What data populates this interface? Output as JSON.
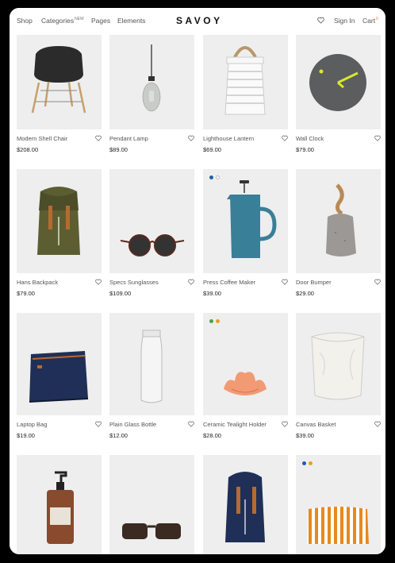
{
  "header": {
    "nav": [
      "Shop",
      "Categories",
      "Pages",
      "Elements"
    ],
    "categories_badge": "NEW",
    "logo": "SAVOY",
    "sign_in": "Sign In",
    "cart": "Cart",
    "cart_count": "0"
  },
  "products": [
    {
      "name": "Modern Shell Chair",
      "price": "$208.00"
    },
    {
      "name": "Pendant Lamp",
      "price": "$89.00"
    },
    {
      "name": "Lighthouse Lantern",
      "price": "$69.00"
    },
    {
      "name": "Wall Clock",
      "price": "$79.00"
    },
    {
      "name": "Hans Backpack",
      "price": "$79.00"
    },
    {
      "name": "Specs Sunglasses",
      "price": "$109.00"
    },
    {
      "name": "Press Coffee Maker",
      "price": "$39.00"
    },
    {
      "name": "Door Bumper",
      "price": "$29.00"
    },
    {
      "name": "Laptop Bag",
      "price": "$19.00"
    },
    {
      "name": "Plain Glass Bottle",
      "price": "$12.00"
    },
    {
      "name": "Ceramic Tealight Holder",
      "price": "$28.00"
    },
    {
      "name": "Canvas Basket",
      "price": "$39.00"
    },
    {
      "name": "",
      "price": ""
    },
    {
      "name": "",
      "price": ""
    },
    {
      "name": "",
      "price": ""
    },
    {
      "name": "",
      "price": ""
    }
  ],
  "colors": {
    "accent_orange": "#e07b39",
    "swatch_blue": "#1f5fa8",
    "swatch_green": "#4aa34a",
    "swatch_orange": "#e8a020",
    "card_bg": "#eeeeee"
  }
}
